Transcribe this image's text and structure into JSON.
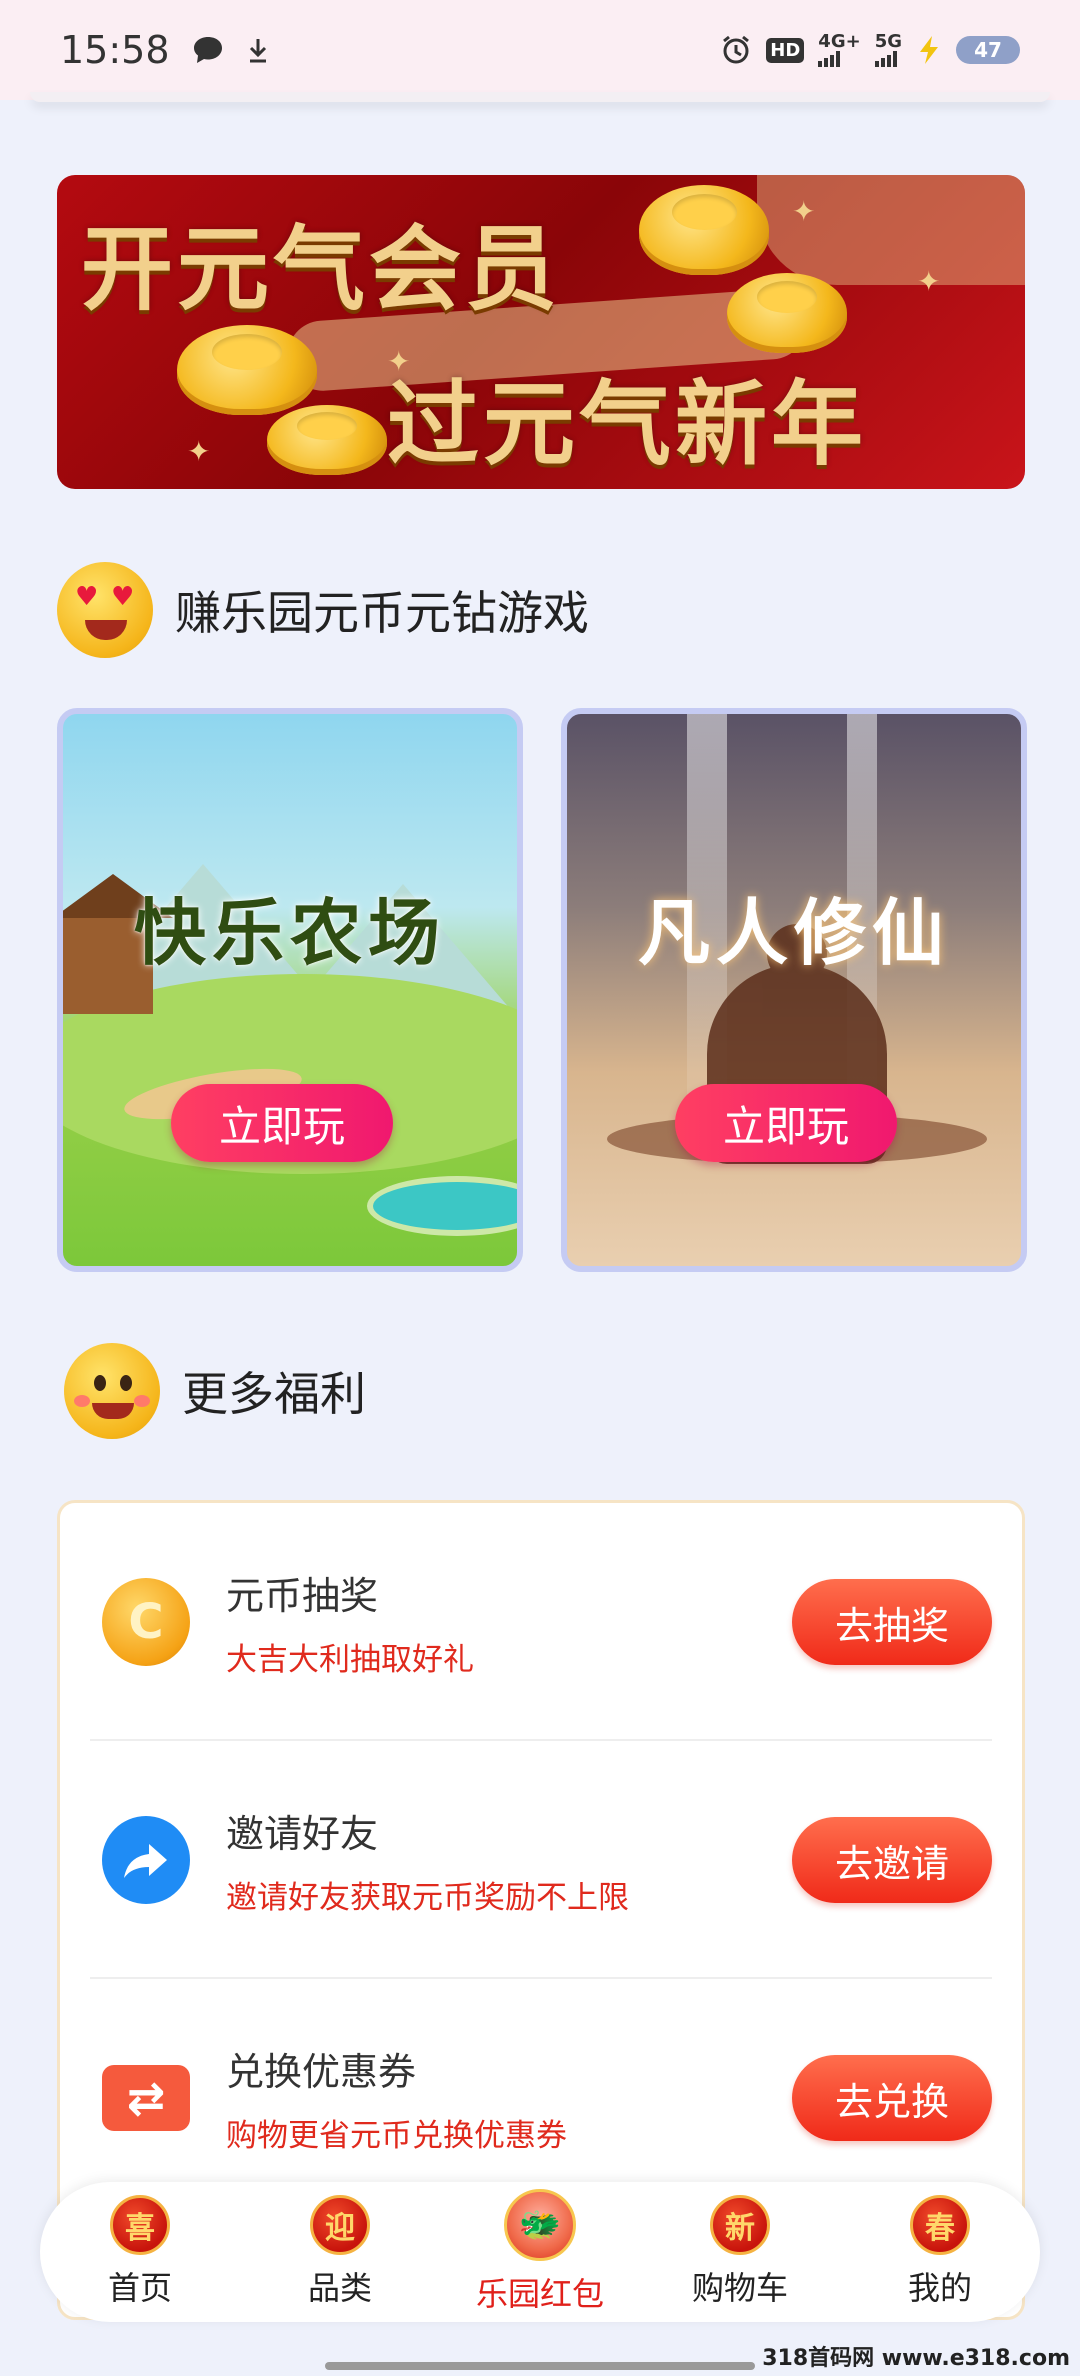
{
  "status_bar": {
    "time": "15:58",
    "hd_label": "HD",
    "net1": "4G+",
    "net2": "5G",
    "battery": "47"
  },
  "banner": {
    "line1": "开元气会员",
    "line2": "过元气新年"
  },
  "games_section": {
    "title": "赚乐园元币元钻游戏",
    "games": [
      {
        "name": "快乐农场",
        "button": "立即玩"
      },
      {
        "name": "凡人修仙",
        "button": "立即玩"
      }
    ]
  },
  "benefits_section": {
    "title": "更多福利",
    "items": [
      {
        "title": "元币抽奖",
        "subtitle": "大吉大利抽取好礼",
        "button": "去抽奖",
        "icon": "coin-icon"
      },
      {
        "title": "邀请好友",
        "subtitle": "邀请好友获取元币奖励不上限",
        "button": "去邀请",
        "icon": "share-icon"
      },
      {
        "title": "兑换优惠券",
        "subtitle": "购物更省元币兑换优惠券",
        "button": "去兑换",
        "icon": "ticket-icon"
      }
    ]
  },
  "bottom_nav": {
    "items": [
      {
        "label": "首页",
        "glyph": "喜"
      },
      {
        "label": "品类",
        "glyph": "迎"
      },
      {
        "label": "乐园红包",
        "glyph": "龙",
        "active": true
      },
      {
        "label": "购物车",
        "glyph": "新"
      },
      {
        "label": "我的",
        "glyph": "春"
      }
    ]
  },
  "watermark": "318首码网 www.e318.com",
  "colors": {
    "accent_red": "#e02a1d",
    "play_button": "#f0186f",
    "background": "#eef1fb"
  }
}
